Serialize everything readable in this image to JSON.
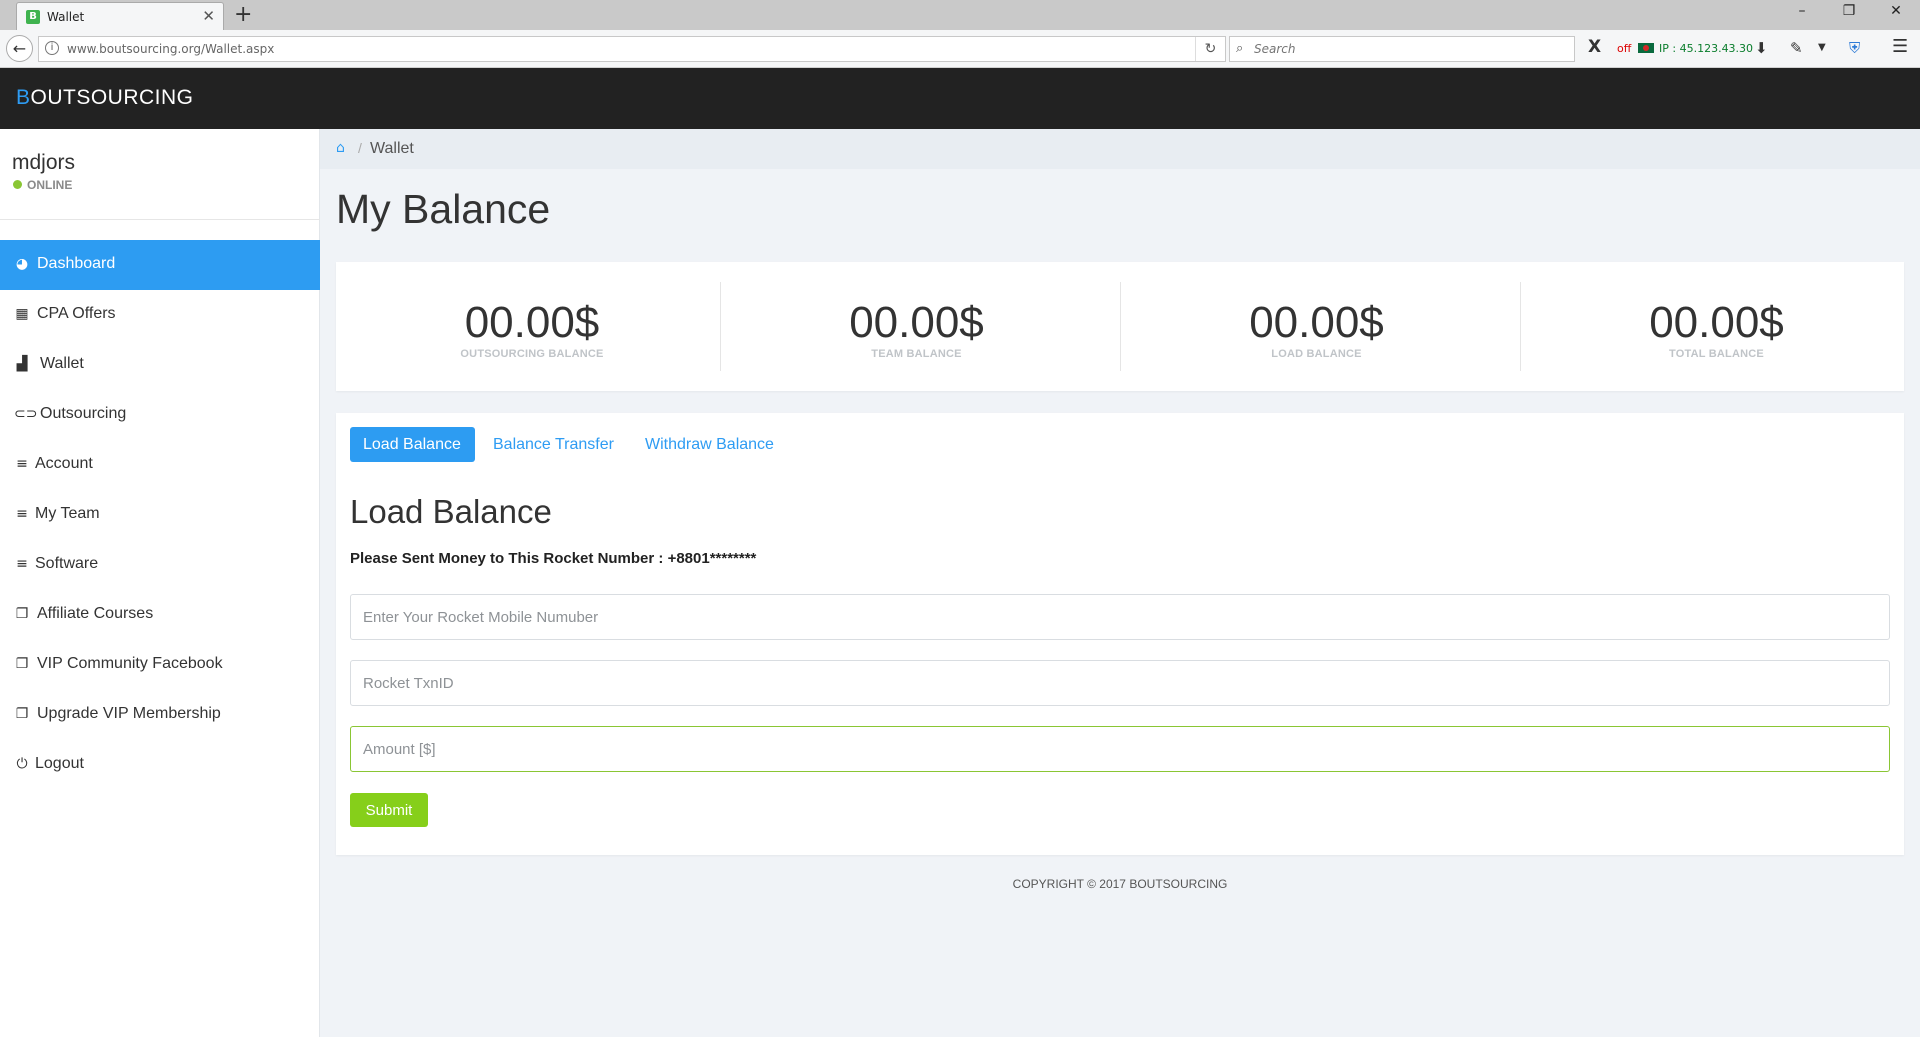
{
  "browser": {
    "tab_title": "Wallet",
    "tab_favicon": "B",
    "new_tab_symbol": "+",
    "url": "www.boutsourcing.org/Wallet.aspx",
    "search_placeholder": "Search",
    "ext_off": "off",
    "ext_ip": "IP : 45.123.43.30",
    "icons": [
      "back-arrow-icon",
      "info-icon",
      "reload-icon",
      "search-icon",
      "x-extension-icon",
      "download-icon",
      "extension-icon",
      "dropdown-icon",
      "shield-extension-icon",
      "hamburger-menu-icon"
    ]
  },
  "header": {
    "brand_first": "B",
    "brand_rest": "OUTSOURCING",
    "brand_accent_color": "#2e9cf3",
    "background_color": "#222222"
  },
  "sidebar": {
    "username": "mdjors",
    "status": "ONLINE",
    "status_color": "#8ac634",
    "items": [
      {
        "label": "Dashboard",
        "icon": "dashboard-icon",
        "active": true
      },
      {
        "label": "CPA Offers",
        "icon": "calendar-icon",
        "active": false
      },
      {
        "label": "Wallet",
        "icon": "bar-chart-icon",
        "active": false
      },
      {
        "label": "Outsourcing",
        "icon": "toggle-icon",
        "active": false
      },
      {
        "label": "Account",
        "icon": "list-icon",
        "active": false
      },
      {
        "label": "My Team",
        "icon": "list-icon",
        "active": false
      },
      {
        "label": "Software",
        "icon": "list-icon",
        "active": false
      },
      {
        "label": "Affiliate Courses",
        "icon": "copy-icon",
        "active": false
      },
      {
        "label": "VIP Community Facebook",
        "icon": "copy-icon",
        "active": false
      },
      {
        "label": "Upgrade VIP Membership",
        "icon": "copy-icon",
        "active": false
      },
      {
        "label": "Logout",
        "icon": "power-icon",
        "active": false
      }
    ]
  },
  "breadcrumb": {
    "separator": "/",
    "current": "Wallet"
  },
  "main": {
    "title": "My Balance",
    "stats": [
      {
        "value": "00.00$",
        "label": "OUTSOURCING BALANCE"
      },
      {
        "value": "00.00$",
        "label": "TEAM BALANCE"
      },
      {
        "value": "00.00$",
        "label": "LOAD BALANCE"
      },
      {
        "value": "00.00$",
        "label": "TOTAL BALANCE"
      }
    ],
    "tabs": [
      {
        "label": "Load Balance",
        "active": true
      },
      {
        "label": "Balance Transfer",
        "active": false
      },
      {
        "label": "Withdraw Balance",
        "active": false
      }
    ],
    "form": {
      "title": "Load Balance",
      "instruction": "Please Sent Money to This Rocket Number : +8801********",
      "mobile_placeholder": "Enter Your Rocket Mobile Numuber",
      "txn_placeholder": "Rocket TxnID",
      "amount_placeholder": "Amount [$]",
      "submit_label": "Submit"
    }
  },
  "footer": {
    "copyright": "COPYRIGHT © 2017 BOUTSOURCING"
  },
  "colors": {
    "primary": "#2d9cf2",
    "success": "#86cf1a",
    "page_background": "#f0f3f7"
  }
}
